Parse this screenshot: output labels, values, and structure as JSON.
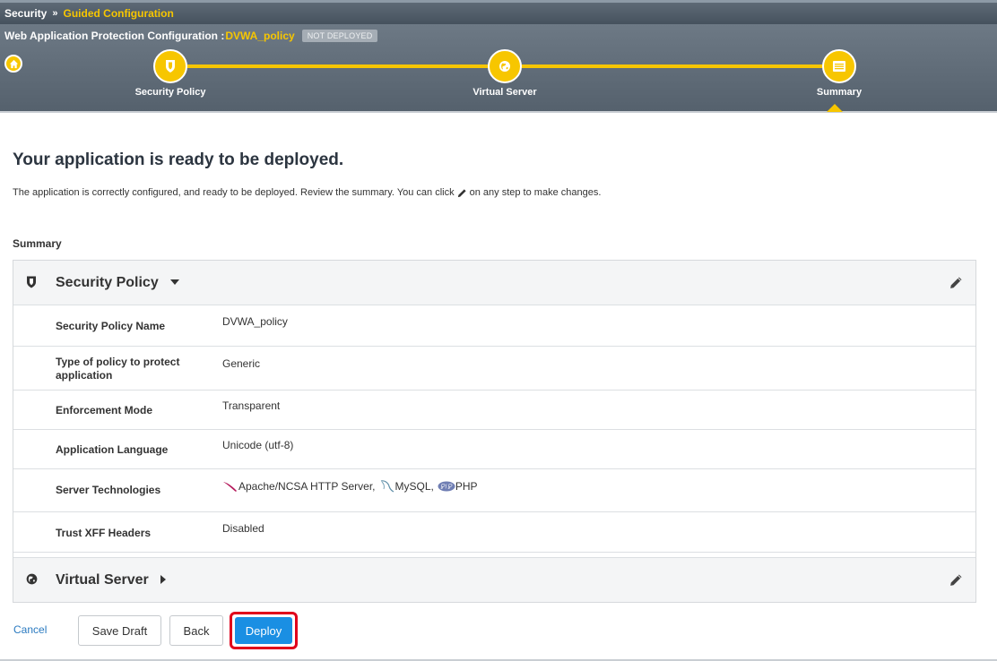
{
  "breadcrumb": {
    "root": "Security",
    "separator": "»",
    "current": "Guided Configuration"
  },
  "wizard": {
    "title_prefix": "Web Application Protection Configuration :",
    "policy_name": "DVWA_policy",
    "status_badge": "NOT DEPLOYED",
    "steps": [
      {
        "label": "Security Policy",
        "icon": "shield-icon"
      },
      {
        "label": "Virtual Server",
        "icon": "globe-icon"
      },
      {
        "label": "Summary",
        "icon": "list-icon",
        "active": true
      }
    ]
  },
  "main": {
    "heading": "Your application is ready to be deployed.",
    "desc_before": "The application is correctly configured, and ready to be deployed. Review the summary. You can click",
    "desc_after": "on any step to make changes.",
    "summary_label": "Summary"
  },
  "sections": {
    "security_policy": {
      "title": "Security Policy",
      "rows": [
        {
          "label": "Security Policy Name",
          "value": "DVWA_policy"
        },
        {
          "label": "Type of policy to protect application",
          "value": "Generic"
        },
        {
          "label": "Enforcement Mode",
          "value": "Transparent"
        },
        {
          "label": "Application Language",
          "value": "Unicode (utf-8)"
        },
        {
          "label": "Server Technologies",
          "value_items": [
            "Apache/NCSA HTTP Server,",
            "MySQL,",
            "PHP"
          ]
        },
        {
          "label": "Trust XFF Headers",
          "value": "Disabled"
        }
      ]
    },
    "virtual_server": {
      "title": "Virtual Server"
    }
  },
  "footer": {
    "cancel": "Cancel",
    "save_draft": "Save Draft",
    "back": "Back",
    "deploy": "Deploy"
  },
  "colors": {
    "accent": "#f7c600",
    "primary_button": "#1a8fe3",
    "highlight": "#e0001b",
    "link": "#2a7ac0"
  }
}
